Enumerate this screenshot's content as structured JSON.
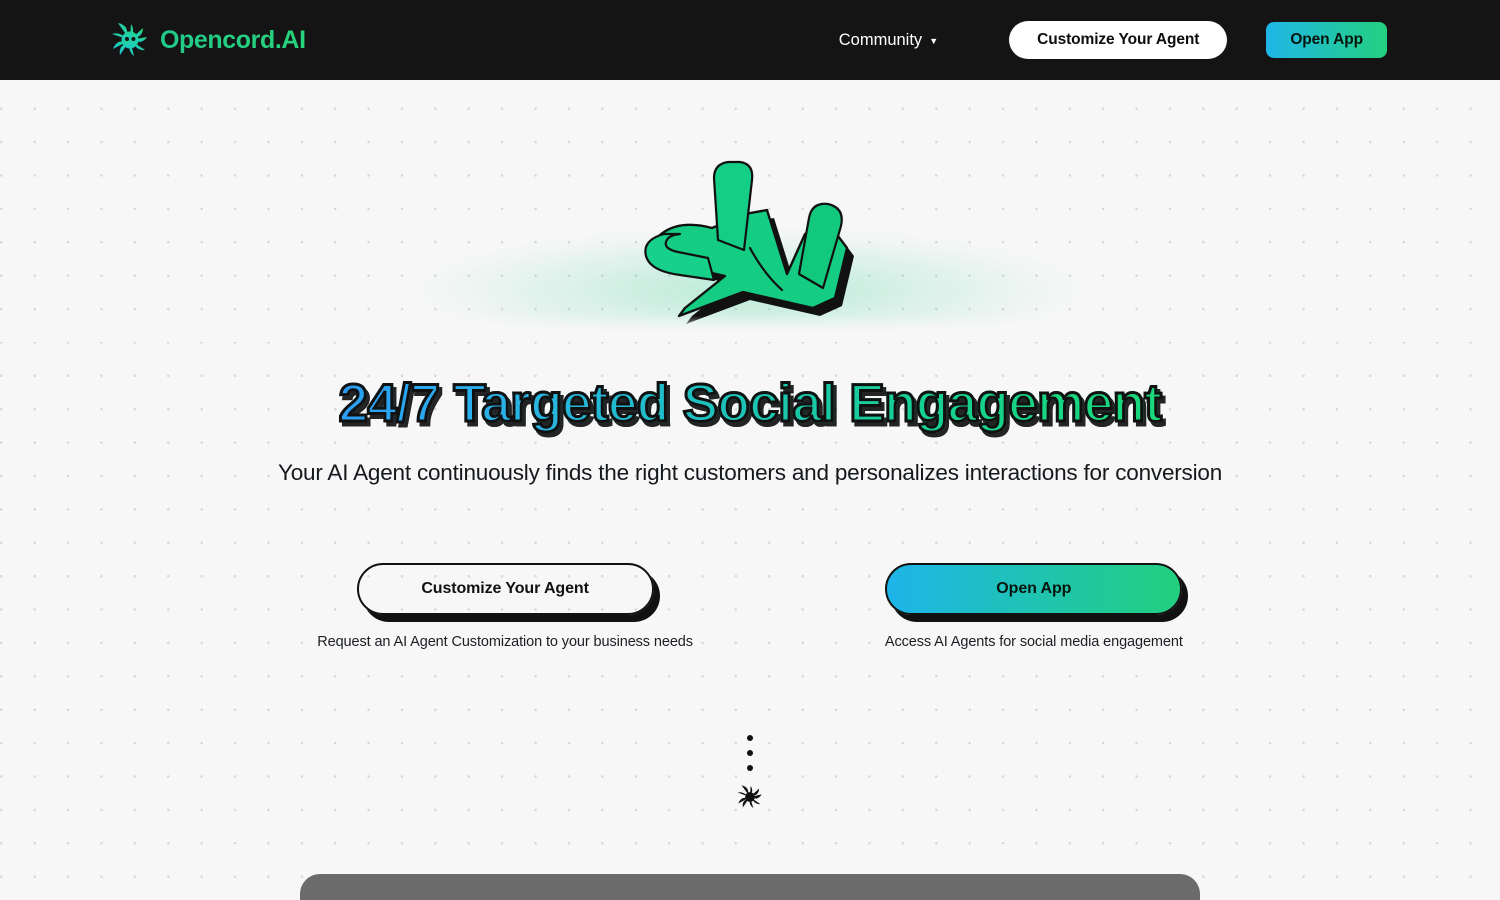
{
  "header": {
    "brand": {
      "name": "Opencord.AI",
      "icon": "spiral-starburst-icon"
    },
    "nav": {
      "community_label": "Community",
      "caret": "▼"
    },
    "customize_button": "Customize Your Agent",
    "open_app_button": "Open App"
  },
  "hero": {
    "illustration": "green-hand-illustration",
    "headline": "24/7 Targeted Social Engagement",
    "subtitle": "Your AI Agent continuously finds the right customers and personalizes interactions for conversion",
    "ctas": [
      {
        "label": "Customize Your Agent",
        "caption": "Request an AI Agent Customization to your business needs",
        "style": "outline"
      },
      {
        "label": "Open App",
        "caption": "Access AI Agents for social media engagement",
        "style": "gradient"
      }
    ]
  },
  "scroll_indicator": {
    "dots": [
      "•",
      "•",
      "•"
    ],
    "mark": "spiral-starburst-icon"
  },
  "colors": {
    "header_bg": "#141414",
    "page_bg": "#f7f7f7",
    "brand_green": "#23d07b",
    "brand_cyan": "#1fb6e8",
    "headline_start": "#2a9df4",
    "headline_end": "#19d979",
    "hand_green": "#14cd83",
    "bottom_panel": "#6b6b6b"
  }
}
